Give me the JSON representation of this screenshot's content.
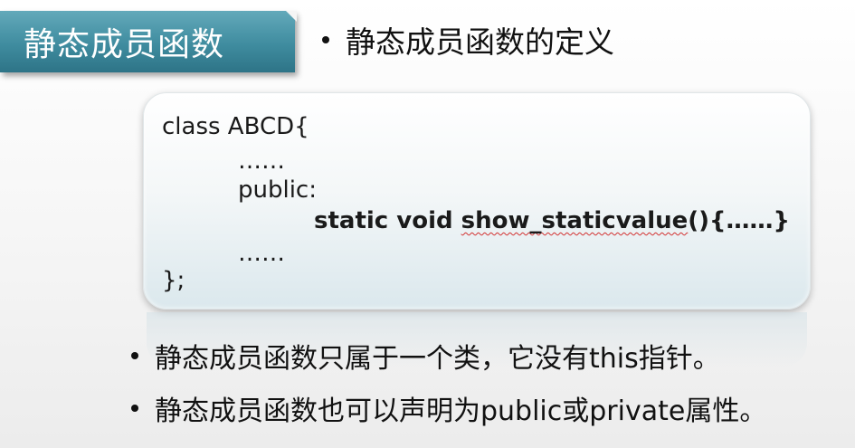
{
  "slide": {
    "title": "静态成员函数",
    "subtitle": "静态成员函数的定义"
  },
  "code": {
    "line1": "class ABCD{",
    "line2": "……",
    "line3": "public:",
    "line4_prefix": "static void ",
    "line4_func": "show_staticvalue",
    "line4_suffix": "(){……}",
    "line5": "……",
    "line6": "};"
  },
  "bullets": [
    "静态成员函数只属于一个类，它没有this指针。",
    "静态成员函数也可以声明为public或private属性。"
  ]
}
